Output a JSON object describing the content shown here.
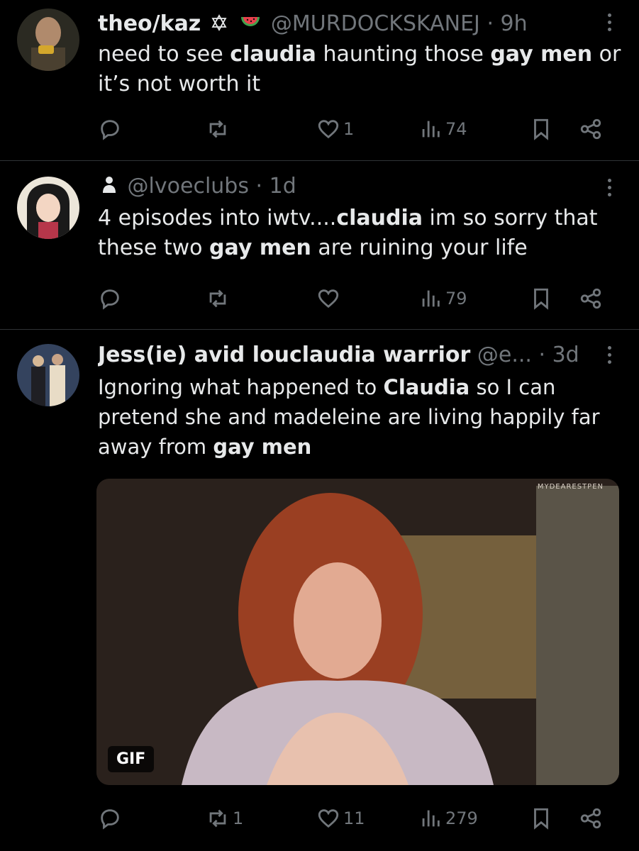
{
  "tweets": [
    {
      "name": "theo/kaz",
      "handle": "@MURDOCKSKANEJ",
      "sep": "·",
      "time": "9h",
      "text_parts": [
        "need to see ",
        "claudia",
        " haunting those ",
        "gay men",
        " or it’s not worth it"
      ],
      "actions": {
        "replies": "",
        "reposts": "",
        "likes": "1",
        "views": "74"
      }
    },
    {
      "name": "",
      "handle": "@lvoeclubs",
      "sep": "·",
      "time": "1d",
      "text_parts": [
        "4 episodes into iwtv....",
        "claudia",
        " im so sorry that these two ",
        "gay men",
        " are ruining your life"
      ],
      "actions": {
        "replies": "",
        "reposts": "",
        "likes": "",
        "views": "79"
      }
    },
    {
      "name": "Jess(ie) avid louclaudia warrior",
      "handle": "@e...",
      "sep": "·",
      "time": "3d",
      "text_parts": [
        "Ignoring what happened to ",
        "Claudia",
        " so I can pretend she and madeleine are living happily far away from ",
        "gay men",
        ""
      ],
      "media": {
        "badge": "GIF",
        "watermark": "MYDEARESTPEN"
      },
      "actions": {
        "replies": "",
        "reposts": "1",
        "likes": "11",
        "views": "279"
      }
    }
  ],
  "icons": [
    "reply-icon",
    "repost-icon",
    "like-icon",
    "views-icon",
    "bookmark-icon",
    "share-icon",
    "more-icon",
    "star-of-david-icon",
    "watermelon-icon",
    "person-icon"
  ],
  "colors": {
    "background": "#000000",
    "text": "#e7e9ea",
    "muted": "#71767b",
    "divider": "#2f3336"
  }
}
